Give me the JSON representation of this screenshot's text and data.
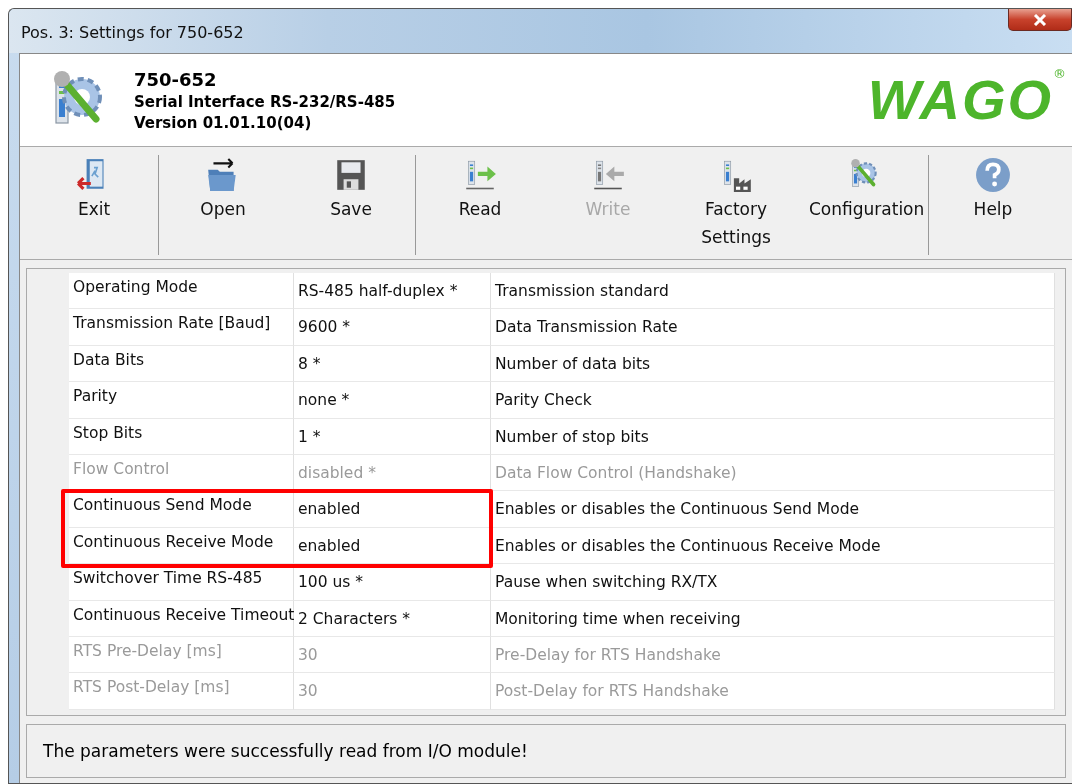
{
  "window": {
    "title": "Pos. 3: Settings for 750-652"
  },
  "header": {
    "model": "750-652",
    "description": "Serial Interface RS-232/RS-485",
    "version": "Version 01.01.10(04)",
    "logo": "WAGO",
    "logo_mark": "®"
  },
  "toolbar": [
    {
      "label": "Exit",
      "kind": "exit",
      "disabled": false,
      "separator_after": true
    },
    {
      "label": "Open",
      "kind": "open",
      "disabled": false,
      "separator_after": false
    },
    {
      "label": "Save",
      "kind": "save",
      "disabled": false,
      "separator_after": true
    },
    {
      "label": "Read",
      "kind": "read",
      "disabled": false,
      "separator_after": false
    },
    {
      "label": "Write",
      "kind": "write",
      "disabled": true,
      "separator_after": false
    },
    {
      "label": "Factory Settings",
      "kind": "factory",
      "disabled": false,
      "separator_after": false
    },
    {
      "label": "Configuration",
      "kind": "config",
      "disabled": false,
      "separator_after": true
    },
    {
      "label": "Help",
      "kind": "help",
      "disabled": false,
      "separator_after": false
    }
  ],
  "table": {
    "rows": [
      {
        "name": "Operating Mode",
        "value": "RS-485 half-duplex *",
        "description": "Transmission standard",
        "disabled": false,
        "highlighted": false
      },
      {
        "name": "Transmission Rate [Baud]",
        "value": "9600 *",
        "description": "Data Transmission Rate",
        "disabled": false,
        "highlighted": false
      },
      {
        "name": "Data Bits",
        "value": "8 *",
        "description": "Number of data bits",
        "disabled": false,
        "highlighted": false
      },
      {
        "name": "Parity",
        "value": "none *",
        "description": "Parity Check",
        "disabled": false,
        "highlighted": false
      },
      {
        "name": "Stop Bits",
        "value": "1 *",
        "description": "Number of stop bits",
        "disabled": false,
        "highlighted": false
      },
      {
        "name": "Flow Control",
        "value": "disabled *",
        "description": "Data Flow Control (Handshake)",
        "disabled": true,
        "highlighted": false
      },
      {
        "name": "Continuous Send Mode",
        "value": "enabled",
        "description": "Enables or disables the Continuous Send Mode",
        "disabled": false,
        "highlighted": true
      },
      {
        "name": "Continuous Receive Mode",
        "value": "enabled",
        "description": "Enables or disables the Continuous Receive Mode",
        "disabled": false,
        "highlighted": true
      },
      {
        "name": "Switchover Time RS-485",
        "value": "100 us *",
        "description": "Pause when switching RX/TX",
        "disabled": false,
        "highlighted": false
      },
      {
        "name": "Continuous Receive Timeout",
        "value": "2 Characters *",
        "description": "Monitoring time when receiving",
        "disabled": false,
        "highlighted": false
      },
      {
        "name": "RTS Pre-Delay [ms]",
        "value": "30",
        "description": "Pre-Delay for RTS Handshake",
        "disabled": true,
        "highlighted": false
      },
      {
        "name": "RTS Post-Delay [ms]",
        "value": "30",
        "description": "Post-Delay for RTS Handshake",
        "disabled": true,
        "highlighted": false
      }
    ]
  },
  "status_bar": {
    "message": "The parameters were successfully read from I/O module!"
  }
}
